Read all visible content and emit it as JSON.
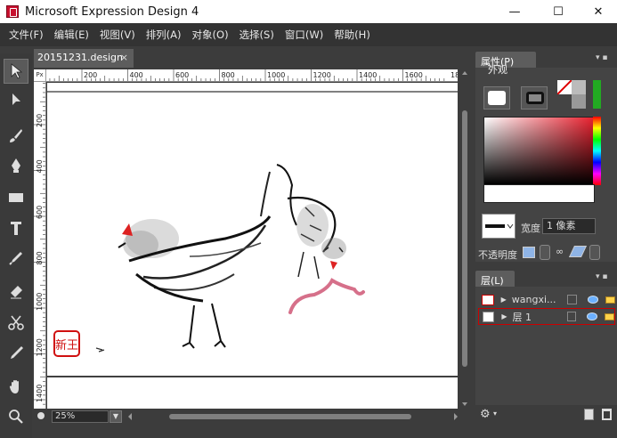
{
  "window": {
    "title": "Microsoft Expression Design 4",
    "minimize": "—",
    "maximize": "☐",
    "close": "✕"
  },
  "menu": [
    "文件(F)",
    "编辑(E)",
    "视图(V)",
    "排列(A)",
    "对象(O)",
    "选择(S)",
    "窗口(W)",
    "帮助(H)"
  ],
  "document": {
    "tab_label": "20151231.design",
    "tab_close": "×",
    "ruler_unit": "Px",
    "hruler_ticks": [
      "200",
      "400",
      "600",
      "800",
      "1000",
      "1200",
      "1400",
      "1600",
      "1800"
    ],
    "vruler_ticks": [
      "200",
      "400",
      "600",
      "800",
      "1000",
      "1200",
      "1400"
    ],
    "zoom": "25%",
    "seal_text": "新王"
  },
  "properties_panel": {
    "tab": "属性(P)",
    "section": "外观",
    "stroke_width_label": "宽度",
    "stroke_width_value": "1 像素",
    "opacity_label": "不透明度",
    "fill_color": "#ffffff",
    "picker_color": "#e8202e"
  },
  "layers_panel": {
    "tab": "层(L)",
    "layers": [
      {
        "name": "wangxi..."
      },
      {
        "name": "层 1",
        "selected": true
      }
    ]
  },
  "colors": {
    "chrome": "#3c3c3c",
    "menubar": "#333333",
    "tab": "#5d5d5d",
    "accent_red": "#cc0000"
  },
  "icons": [
    "selection-icon",
    "direct-selection-icon",
    "brush-icon",
    "pen-icon",
    "rectangle-icon",
    "text-icon",
    "eyedropper-icon",
    "eraser-icon",
    "scissors-icon",
    "knife-icon",
    "hand-icon",
    "zoom-icon",
    "gear-icon",
    "new-layer-icon",
    "trash-icon",
    "eye-icon",
    "lock-icon"
  ]
}
